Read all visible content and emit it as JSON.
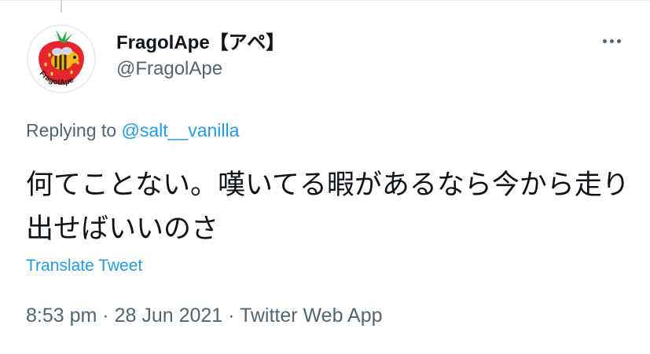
{
  "tweet": {
    "author": {
      "display_name": "FragolApe【アペ】",
      "handle": "@FragolApe",
      "avatar_text": "FragolApe",
      "avatar_icon": "strawberry-bee-avatar"
    },
    "more_icon": "more-dots-icon",
    "reply_context": {
      "prefix": "Replying to ",
      "mention": "@salt__vanilla"
    },
    "text": "何てことない。嘆いてる暇があるなら今から走り出せばいいのさ",
    "translate_label": "Translate Tweet",
    "time": "8:53 pm",
    "separator": " · ",
    "date": "28 Jun 2021",
    "source": "Twitter Web App"
  },
  "colors": {
    "primary_text": "#0f1419",
    "secondary_text": "#536471",
    "link": "#1d9bf0",
    "border": "#e6ecf0"
  }
}
